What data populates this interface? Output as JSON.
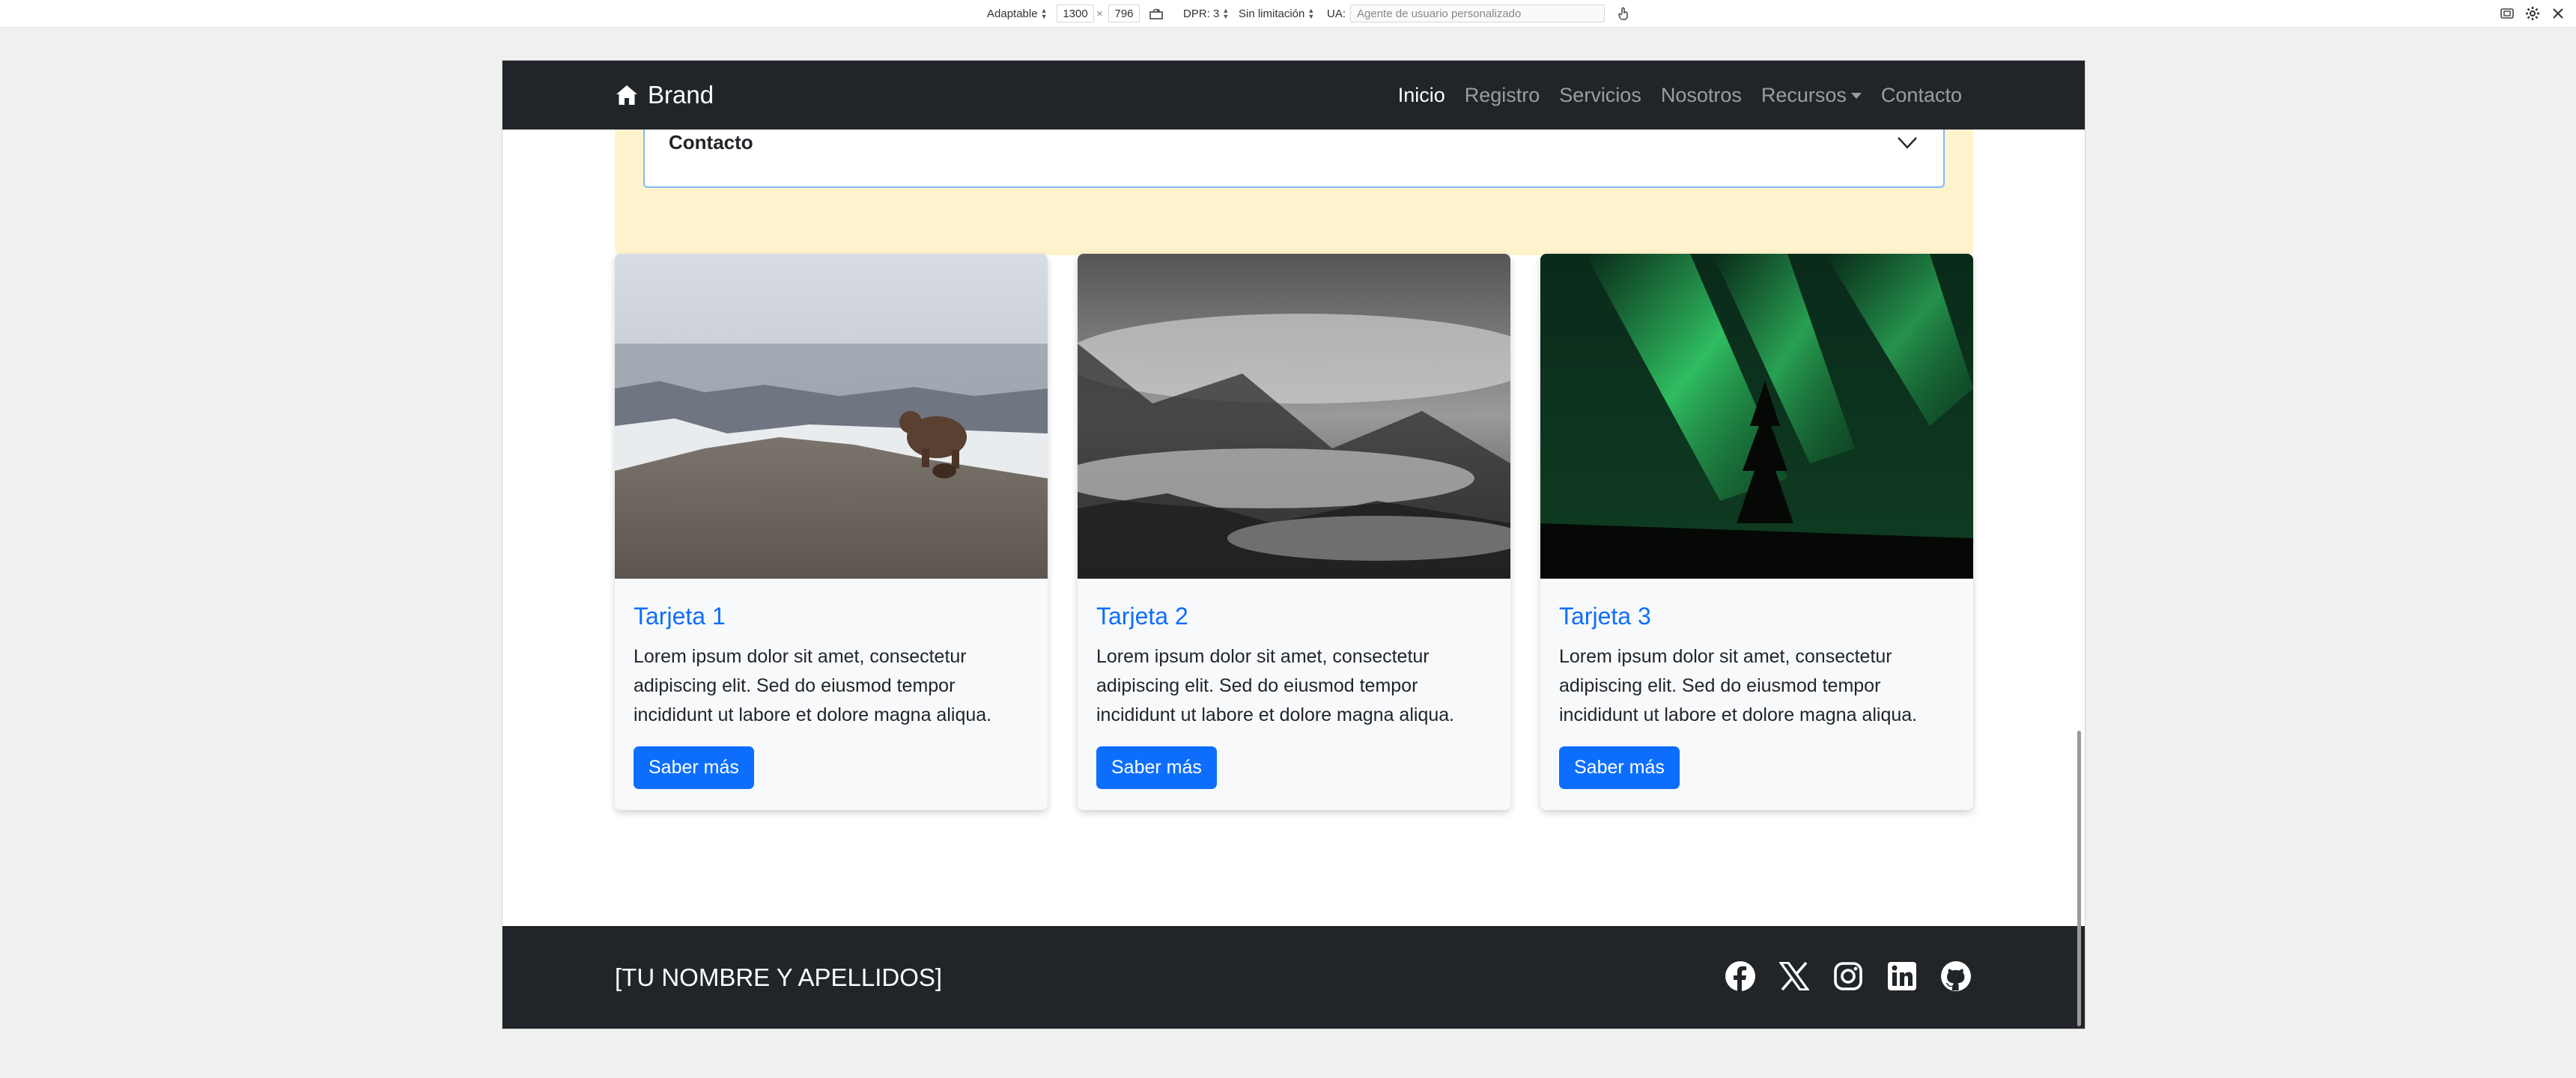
{
  "devtools": {
    "device": "Adaptable",
    "width": "1300",
    "times": "×",
    "height": "796",
    "dpr": "DPR: 3",
    "throttle": "Sin limitación",
    "ua_label": "UA:",
    "ua_placeholder": "Agente de usuario personalizado",
    "icons": [
      "rotate-icon",
      "touch-icon",
      "screenshot-icon",
      "settings-icon",
      "close-icon"
    ]
  },
  "navbar": {
    "brand": "Brand",
    "links": [
      {
        "label": "Inicio",
        "active": true
      },
      {
        "label": "Registro"
      },
      {
        "label": "Servicios"
      },
      {
        "label": "Nosotros"
      },
      {
        "label": "Recursos",
        "dropdown": true
      },
      {
        "label": "Contacto"
      }
    ]
  },
  "contact": {
    "label": "Contacto"
  },
  "cards": [
    {
      "title": "Tarjeta 1",
      "text": "Lorem ipsum dolor sit amet, consectetur adipiscing elit. Sed do eiusmod tempor incididunt ut labore et dolore magna aliqua.",
      "button": "Saber más",
      "image": "bear-photo"
    },
    {
      "title": "Tarjeta 2",
      "text": "Lorem ipsum dolor sit amet, consectetur adipiscing elit. Sed do eiusmod tempor incididunt ut labore et dolore magna aliqua.",
      "button": "Saber más",
      "image": "foggy-forest-photo"
    },
    {
      "title": "Tarjeta 3",
      "text": "Lorem ipsum dolor sit amet, consectetur adipiscing elit. Sed do eiusmod tempor incididunt ut labore et dolore magna aliqua.",
      "button": "Saber más",
      "image": "aurora-photo"
    }
  ],
  "footer": {
    "name": "[TU NOMBRE Y APELLIDOS]",
    "socials": [
      "facebook-icon",
      "x-icon",
      "instagram-icon",
      "linkedin-icon",
      "github-icon"
    ]
  },
  "colors": {
    "navbar_bg": "#212529",
    "primary": "#0d6efd",
    "contact_bg": "#fff3cd",
    "card_bg": "#f8f9fa"
  }
}
